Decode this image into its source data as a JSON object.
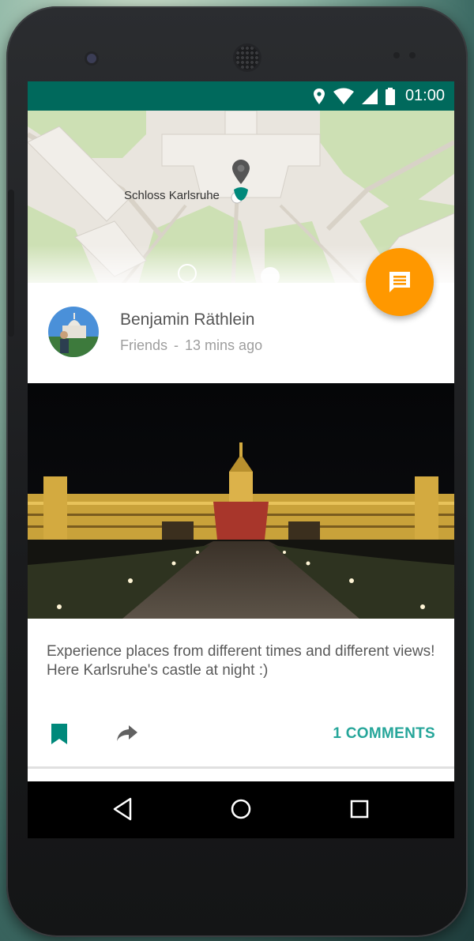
{
  "status_bar": {
    "time": "01:00",
    "icons": [
      "location-icon",
      "wifi-icon",
      "cell-signal-icon",
      "battery-icon"
    ],
    "color": "#00695c"
  },
  "map": {
    "place_label": "Schloss Karlsruhe",
    "marker_color": "#009688"
  },
  "fab": {
    "icon": "message-icon",
    "color": "#ff9800"
  },
  "post": {
    "author": "Benjamin Räthlein",
    "audience": "Friends",
    "separator": "-",
    "time_ago": "13 mins ago",
    "caption": "Experience places from different times and different views! Here Karlsruhe's castle at night :)",
    "comments_label": "1 COMMENTS",
    "accent": "#26a69a"
  },
  "nav": {
    "back": "back-icon",
    "home": "home-icon",
    "recents": "recents-icon"
  }
}
